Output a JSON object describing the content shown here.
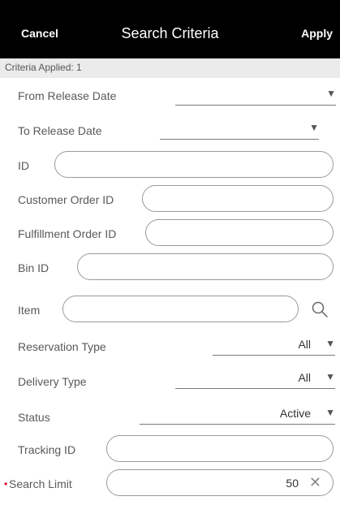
{
  "header": {
    "cancel_label": "Cancel",
    "title": "Search Criteria",
    "apply_label": "Apply"
  },
  "criteria_applied": "Criteria Applied: 1",
  "fields": {
    "from_release_date": {
      "label": "From Release Date",
      "value": ""
    },
    "to_release_date": {
      "label": "To Release Date",
      "value": ""
    },
    "id": {
      "label": "ID",
      "value": ""
    },
    "customer_order_id": {
      "label": "Customer Order ID",
      "value": ""
    },
    "fulfillment_order_id": {
      "label": "Fulfillment Order ID",
      "value": ""
    },
    "bin_id": {
      "label": "Bin ID",
      "value": ""
    },
    "item": {
      "label": "Item",
      "value": ""
    },
    "reservation_type": {
      "label": "Reservation Type",
      "value": "All"
    },
    "delivery_type": {
      "label": "Delivery Type",
      "value": "All"
    },
    "status": {
      "label": "Status",
      "value": "Active"
    },
    "tracking_id": {
      "label": "Tracking ID",
      "value": ""
    },
    "search_limit": {
      "label": "Search Limit",
      "value": "50",
      "required_marker": "•"
    }
  },
  "icons": {
    "dropdown": "▼",
    "clear": "✕",
    "search": "search-icon"
  },
  "colors": {
    "header_bg": "#000000",
    "criteria_bar_bg": "#ebebeb",
    "required": "#d0021b"
  }
}
